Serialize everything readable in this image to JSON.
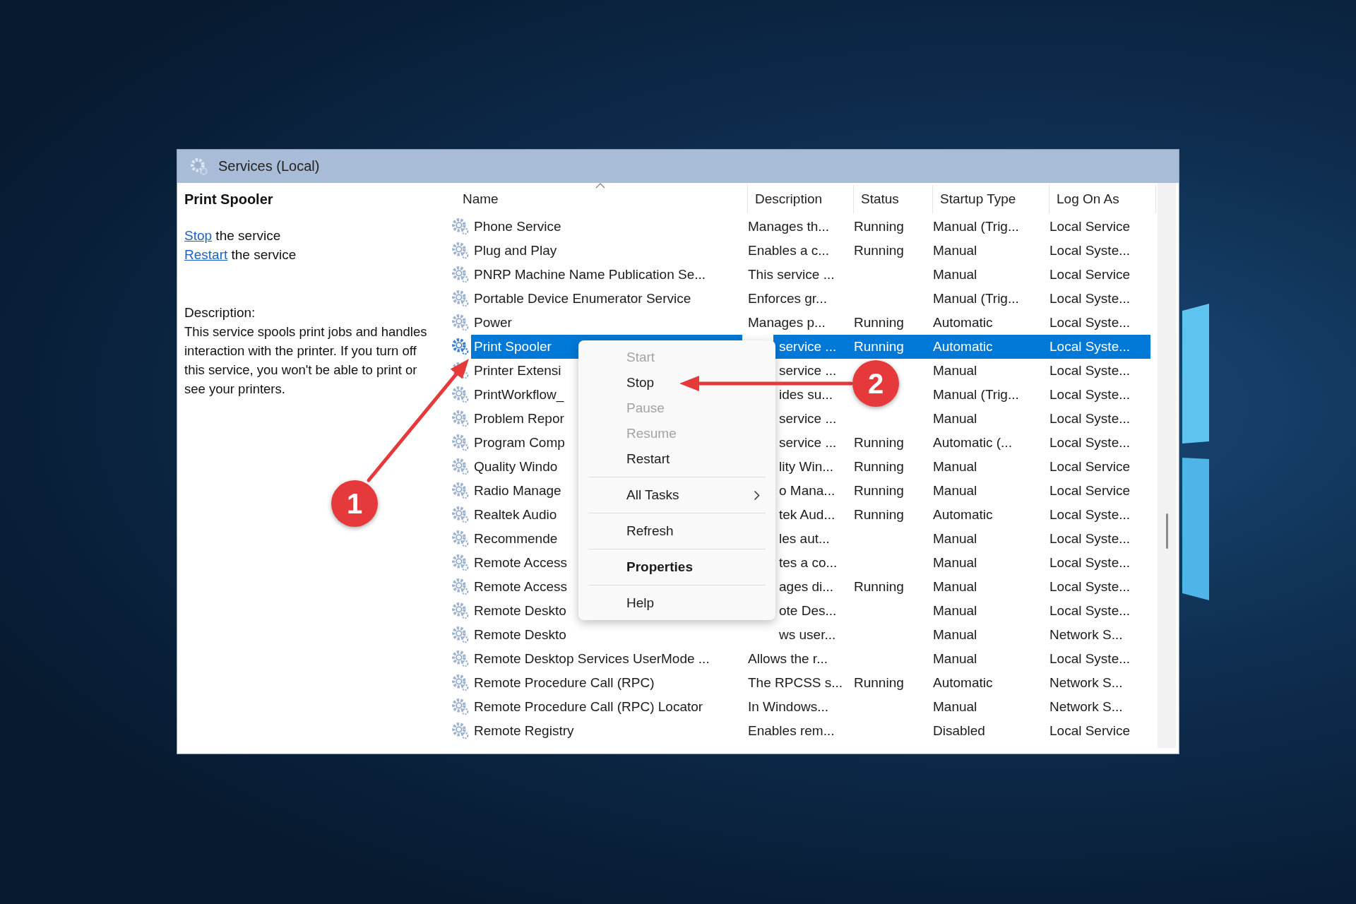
{
  "window": {
    "title": "Services (Local)"
  },
  "details": {
    "title": "Print Spooler",
    "actions": [
      {
        "link": "Stop",
        "text": "the service"
      },
      {
        "link": "Restart",
        "text": "the service"
      }
    ],
    "description_label": "Description:",
    "description": "This service spools print jobs and handles interaction with the printer. If you turn off this service, you won't be able to print or see your printers."
  },
  "table": {
    "columns": [
      "Name",
      "Description",
      "Status",
      "Startup Type",
      "Log On As"
    ],
    "rows": [
      {
        "cells": [
          "Phone Service",
          "Manages th...",
          "Running",
          "Manual (Trig...",
          "Local Service"
        ],
        "selected": false
      },
      {
        "cells": [
          "Plug and Play",
          "Enables a c...",
          "Running",
          "Manual",
          "Local Syste..."
        ],
        "selected": false
      },
      {
        "cells": [
          "PNRP Machine Name Publication Se...",
          "This service ...",
          "",
          "Manual",
          "Local Service"
        ],
        "selected": false
      },
      {
        "cells": [
          "Portable Device Enumerator Service",
          "Enforces gr...",
          "",
          "Manual (Trig...",
          "Local Syste..."
        ],
        "selected": false
      },
      {
        "cells": [
          "Power",
          "Manages p...",
          "Running",
          "Automatic",
          "Local Syste..."
        ],
        "selected": false
      },
      {
        "cells": [
          "Print Spooler",
          "service ...",
          "Running",
          "Automatic",
          "Local Syste..."
        ],
        "selected": true
      },
      {
        "cells": [
          "Printer Extensi",
          "service ...",
          "",
          "Manual",
          "Local Syste..."
        ],
        "selected": false
      },
      {
        "cells": [
          "PrintWorkflow_",
          "ides su...",
          "",
          "Manual (Trig...",
          "Local Syste..."
        ],
        "selected": false
      },
      {
        "cells": [
          "Problem Repor",
          "service ...",
          "",
          "Manual",
          "Local Syste..."
        ],
        "selected": false
      },
      {
        "cells": [
          "Program Comp",
          "service ...",
          "Running",
          "Automatic (...",
          "Local Syste..."
        ],
        "selected": false
      },
      {
        "cells": [
          "Quality Windo",
          "lity Win...",
          "Running",
          "Manual",
          "Local Service"
        ],
        "selected": false
      },
      {
        "cells": [
          "Radio Manage",
          "o Mana...",
          "Running",
          "Manual",
          "Local Service"
        ],
        "selected": false
      },
      {
        "cells": [
          "Realtek Audio",
          "tek Aud...",
          "Running",
          "Automatic",
          "Local Syste..."
        ],
        "selected": false
      },
      {
        "cells": [
          "Recommende",
          "les aut...",
          "",
          "Manual",
          "Local Syste..."
        ],
        "selected": false
      },
      {
        "cells": [
          "Remote Access",
          "tes a co...",
          "",
          "Manual",
          "Local Syste..."
        ],
        "selected": false
      },
      {
        "cells": [
          "Remote Access",
          "ages di...",
          "Running",
          "Manual",
          "Local Syste..."
        ],
        "selected": false
      },
      {
        "cells": [
          "Remote Deskto",
          "ote Des...",
          "",
          "Manual",
          "Local Syste..."
        ],
        "selected": false
      },
      {
        "cells": [
          "Remote Deskto",
          "ws user...",
          "",
          "Manual",
          "Network S..."
        ],
        "selected": false
      },
      {
        "cells": [
          "Remote Desktop Services UserMode ...",
          "Allows the r...",
          "",
          "Manual",
          "Local Syste..."
        ],
        "selected": false
      },
      {
        "cells": [
          "Remote Procedure Call (RPC)",
          "The RPCSS s...",
          "Running",
          "Automatic",
          "Network S..."
        ],
        "selected": false
      },
      {
        "cells": [
          "Remote Procedure Call (RPC) Locator",
          "In Windows...",
          "",
          "Manual",
          "Network S..."
        ],
        "selected": false
      },
      {
        "cells": [
          "Remote Registry",
          "Enables rem...",
          "",
          "Disabled",
          "Local Service"
        ],
        "selected": false
      }
    ]
  },
  "context_menu": {
    "items": [
      {
        "kind": "item",
        "label": "Start",
        "disabled": true
      },
      {
        "kind": "item",
        "label": "Stop",
        "disabled": false
      },
      {
        "kind": "item",
        "label": "Pause",
        "disabled": true
      },
      {
        "kind": "item",
        "label": "Resume",
        "disabled": true
      },
      {
        "kind": "item",
        "label": "Restart",
        "disabled": false
      },
      {
        "kind": "separator"
      },
      {
        "kind": "item",
        "label": "All Tasks",
        "disabled": false,
        "submenu": true
      },
      {
        "kind": "separator"
      },
      {
        "kind": "item",
        "label": "Refresh",
        "disabled": false
      },
      {
        "kind": "separator"
      },
      {
        "kind": "item",
        "label": "Properties",
        "disabled": false,
        "default": true
      },
      {
        "kind": "separator"
      },
      {
        "kind": "item",
        "label": "Help",
        "disabled": false
      }
    ]
  },
  "annotations": [
    {
      "label": "1"
    },
    {
      "label": "2"
    }
  ]
}
